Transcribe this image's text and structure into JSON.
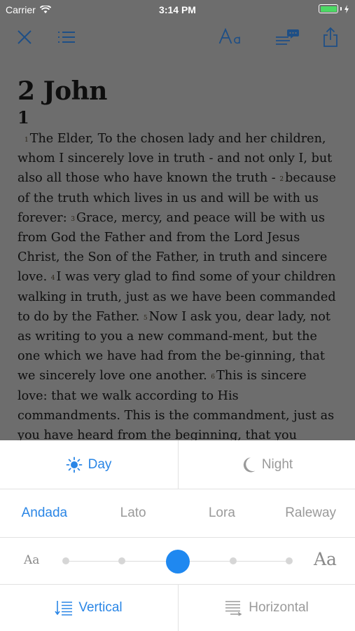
{
  "status_bar": {
    "carrier": "Carrier",
    "time": "3:14 PM",
    "battery_color": "#4cd964"
  },
  "toolbar": {
    "close_icon": "close-icon",
    "contents_icon": "list-icon",
    "font_settings_icon": "text-size-icon",
    "notes_icon": "notes-chat-icon",
    "share_icon": "share-icon",
    "accent_color": "#1e4f86"
  },
  "reader": {
    "book_title": "2 John",
    "chapter": "1",
    "verses": [
      {
        "num": "1",
        "text": "The Elder, To the chosen lady and her children, whom I sincerely love in truth - and not only I, but also all those who have known the truth - "
      },
      {
        "num": "2",
        "text": "because of the truth which lives in us and will be with us forever: "
      },
      {
        "num": "3",
        "text": "Grace, mercy, and peace will be with us from God the Father and from the Lord Jesus Christ, the Son of the Father, in truth and sincere love. "
      },
      {
        "num": "4",
        "text": "I was very glad to find some of your children walking in truth, just as we have been commanded to do by the Father. "
      },
      {
        "num": "5",
        "text": "Now I ask you, dear lady, not as writing to you a new command-ment, but the one which we have had from the be-ginning, that we sincerely love one another. "
      },
      {
        "num": "6",
        "text": "This is sincere love: that we walk according to His commandments. This is the commandment, just as you have heard from the beginning, that you"
      }
    ]
  },
  "settings": {
    "accent_color": "#2a86e6",
    "theme": {
      "day_label": "Day",
      "night_label": "Night",
      "selected": "Day"
    },
    "fonts": {
      "options": [
        "Andada",
        "Lato",
        "Lora",
        "Raleway"
      ],
      "selected": "Andada"
    },
    "text_size": {
      "small_label": "Aa",
      "large_label": "Aa",
      "steps": 5,
      "selected_step": 3
    },
    "scroll": {
      "vertical_label": "Vertical",
      "horizontal_label": "Horizontal",
      "selected": "Vertical"
    }
  }
}
